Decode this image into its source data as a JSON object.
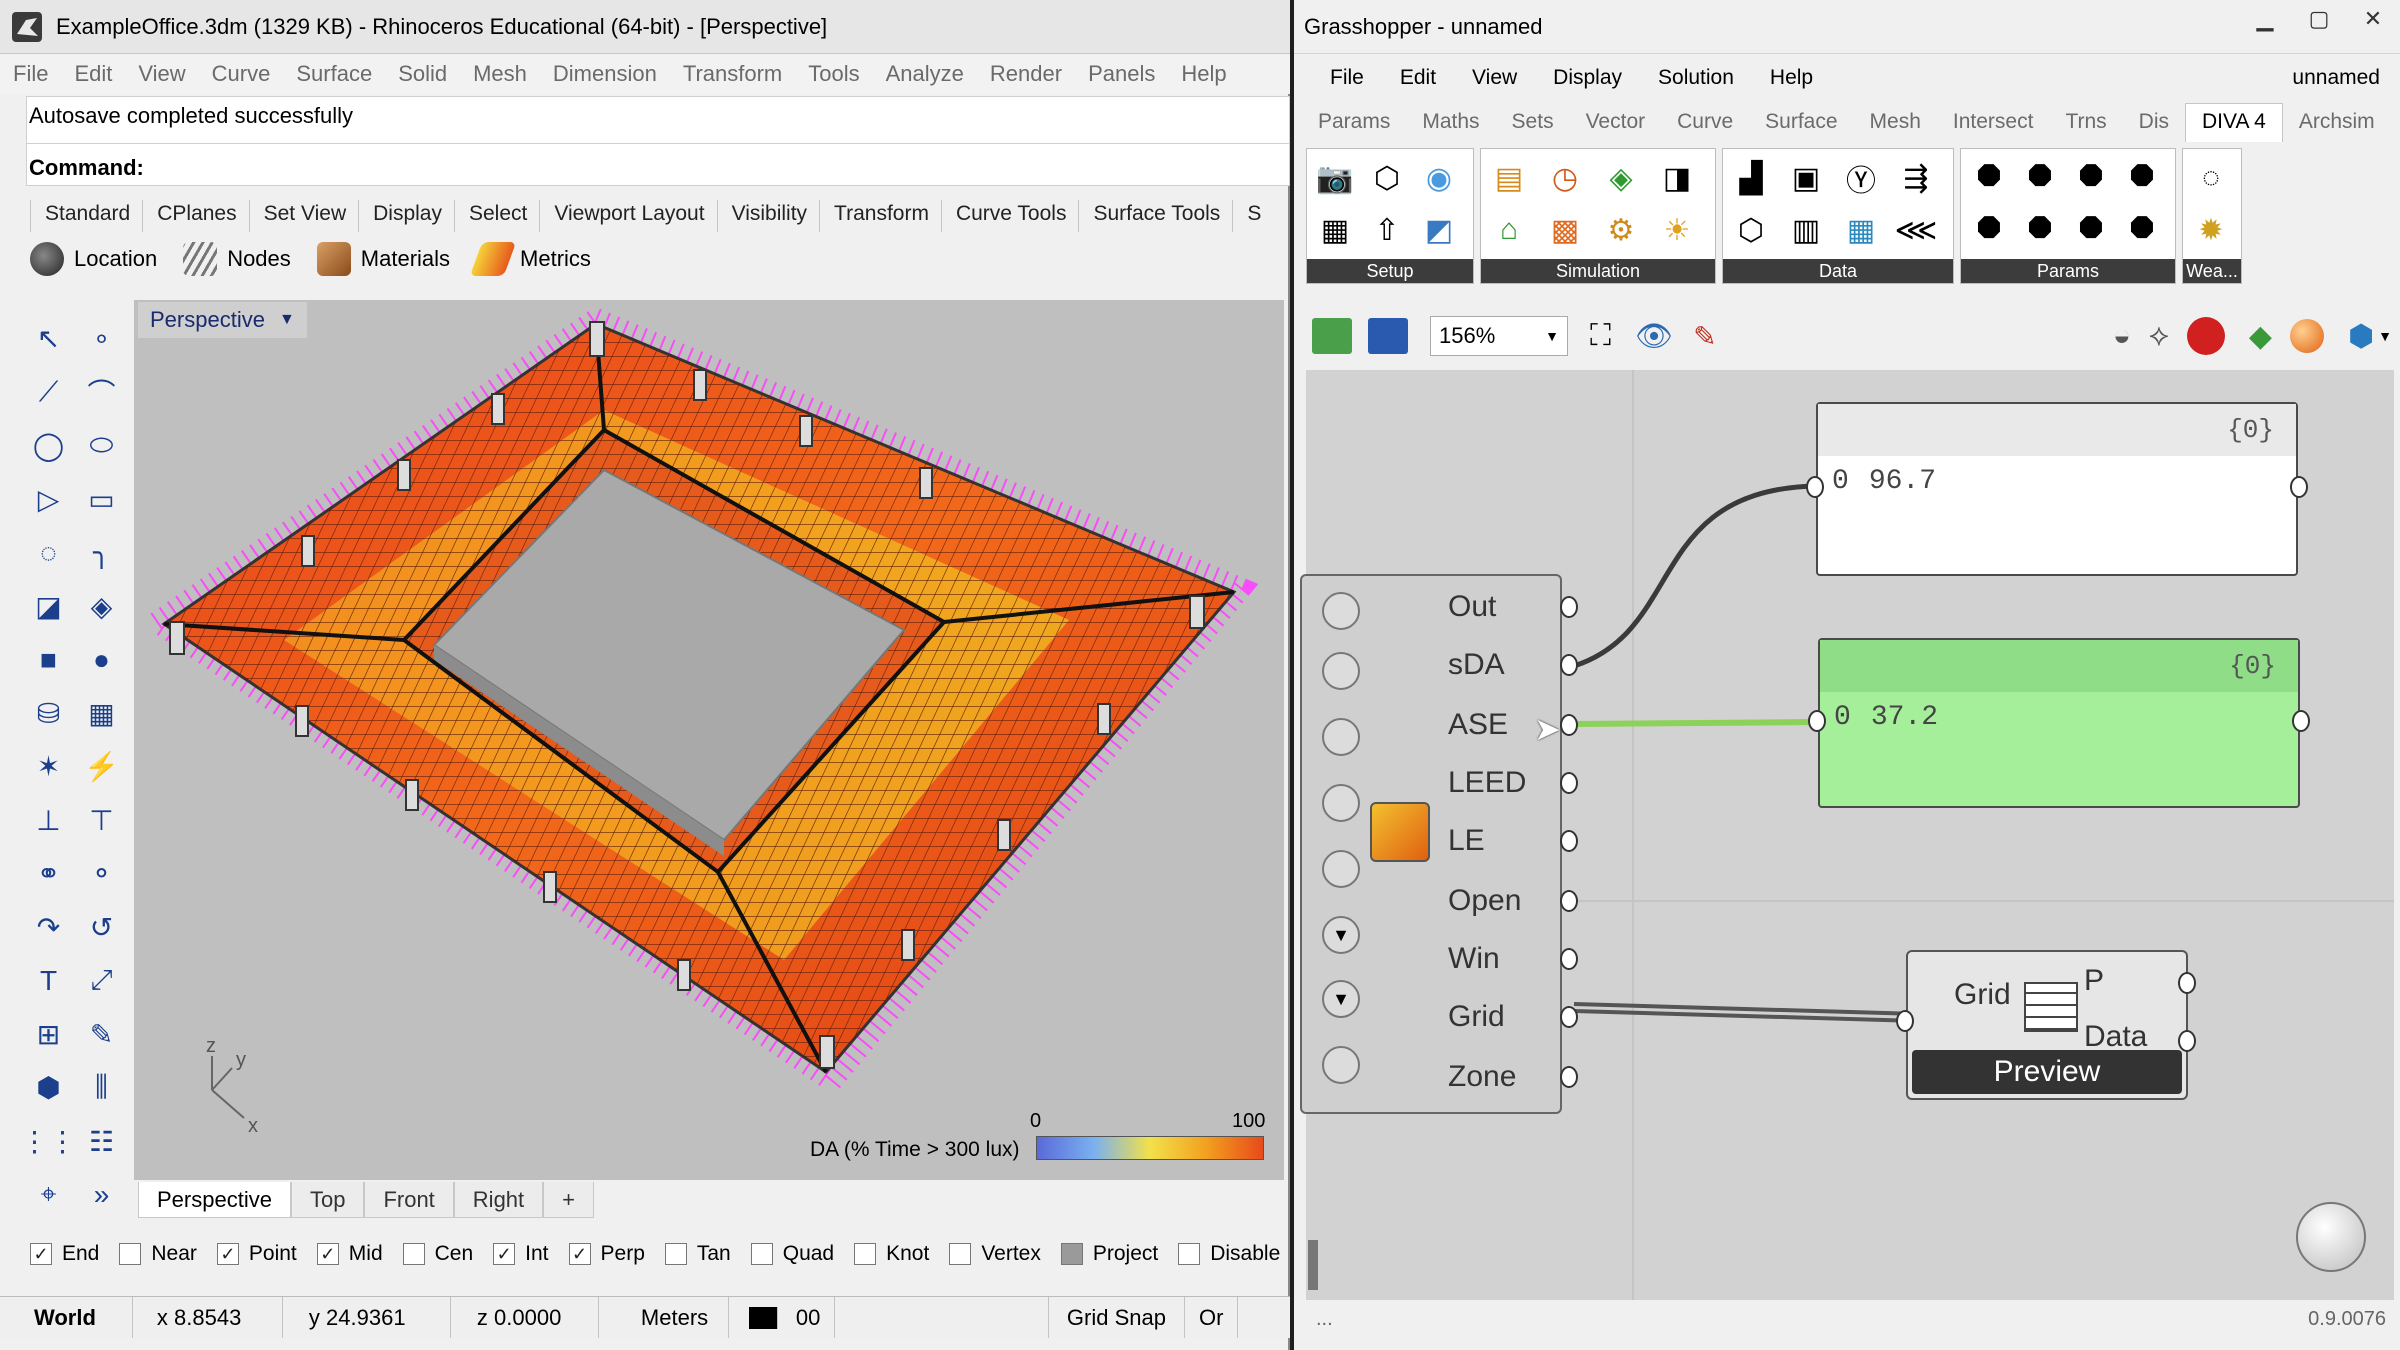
{
  "rhino": {
    "title": "ExampleOffice.3dm (1329 KB) - Rhinoceros Educational (64-bit) - [Perspective]",
    "menu": [
      "File",
      "Edit",
      "View",
      "Curve",
      "Surface",
      "Solid",
      "Mesh",
      "Dimension",
      "Transform",
      "Tools",
      "Analyze",
      "Render",
      "Panels",
      "Help"
    ],
    "history_line": "Autosave completed successfully",
    "command_label": "Command:",
    "toolbar_tabs": [
      "Standard",
      "CPlanes",
      "Set View",
      "Display",
      "Select",
      "Viewport Layout",
      "Visibility",
      "Transform",
      "Curve Tools",
      "Surface Tools",
      "S"
    ],
    "diva_tools": [
      {
        "label": "Location",
        "icon": "globe-icon",
        "color": "#2a2a2a"
      },
      {
        "label": "Nodes",
        "icon": "nodes-icon",
        "color": "#666666"
      },
      {
        "label": "Materials",
        "icon": "materials-icon",
        "color": "#a25a2a"
      },
      {
        "label": "Metrics",
        "icon": "metrics-icon",
        "color": "#d46a20"
      }
    ],
    "viewport": {
      "name": "Perspective",
      "legend_label": "DA (% Time > 300 lux)",
      "legend_min": "0",
      "legend_max": "100",
      "axis_z": "z",
      "axis_y": "y",
      "axis_x": "x"
    },
    "viewport_tabs": [
      "Perspective",
      "Top",
      "Front",
      "Right"
    ],
    "add_tab": "+",
    "osnaps": [
      {
        "label": "End",
        "checked": true
      },
      {
        "label": "Near",
        "checked": false
      },
      {
        "label": "Point",
        "checked": true
      },
      {
        "label": "Mid",
        "checked": true
      },
      {
        "label": "Cen",
        "checked": false
      },
      {
        "label": "Int",
        "checked": true
      },
      {
        "label": "Perp",
        "checked": true
      },
      {
        "label": "Tan",
        "checked": false
      },
      {
        "label": "Quad",
        "checked": false
      },
      {
        "label": "Knot",
        "checked": false
      },
      {
        "label": "Vertex",
        "checked": false
      },
      {
        "label": "Project",
        "checked": false
      },
      {
        "label": "Disable",
        "checked": false
      }
    ],
    "status": {
      "cplane": "World",
      "x": "x 8.8543",
      "y": "y 24.9361",
      "z": "z 0.0000",
      "units": "Meters",
      "layer": "00",
      "gridsnap": "Grid Snap",
      "ortho": "Or"
    }
  },
  "grasshopper": {
    "title": "Grasshopper - unnamed",
    "doc_name": "unnamed",
    "menu": [
      "File",
      "Edit",
      "View",
      "Display",
      "Solution",
      "Help"
    ],
    "tabs": [
      "Params",
      "Maths",
      "Sets",
      "Vector",
      "Curve",
      "Surface",
      "Mesh",
      "Intersect",
      "Trns",
      "Dis",
      "DIVA 4",
      "Archsim"
    ],
    "active_tab": "DIVA 4",
    "groups": [
      {
        "label": "Setup",
        "icons": [
          "camera-icon",
          "cube-icon",
          "sphere-icon",
          "grid-icon",
          "arrow-up-icon",
          "panel-icon"
        ]
      },
      {
        "label": "Simulation",
        "icons": [
          "daylight-icon",
          "clock-icon",
          "energy-icon",
          "glare-icon",
          "radiation-icon",
          "sun-icon",
          "sun-grid-icon",
          "gear-icon"
        ]
      },
      {
        "label": "Data",
        "icons": [
          "bar-chart-icon",
          "cube-outline-icon",
          "metrics-icon",
          "split-icon",
          "merge-icon",
          "arrow-icon",
          "readout-icon",
          "splitter-icon"
        ]
      },
      {
        "label": "Params",
        "icons": [
          "octagon-icon",
          "hex-grid-icon",
          "shape-icon",
          "octagon2-icon",
          "bar2-icon",
          "hex-icon",
          "octagon3-icon",
          "octagon4-icon"
        ]
      },
      {
        "label": "Wea...",
        "icons": [
          "weather-icon",
          "sun-weather-icon"
        ]
      }
    ],
    "zoom": "156%",
    "panel1": {
      "path": "{0}",
      "index": "0",
      "value": "96.7"
    },
    "panel2": {
      "path": "{0}",
      "index": "0",
      "value": "37.2"
    },
    "metrics_outputs": [
      "Out",
      "sDA",
      "ASE",
      "LEED",
      "LE",
      "Open",
      "Win",
      "Grid",
      "Zone"
    ],
    "viewer": {
      "input": "Grid",
      "outputs": [
        "P",
        "Data"
      ],
      "button": "Preview"
    },
    "version": "0.9.0076",
    "status_left": "..."
  }
}
